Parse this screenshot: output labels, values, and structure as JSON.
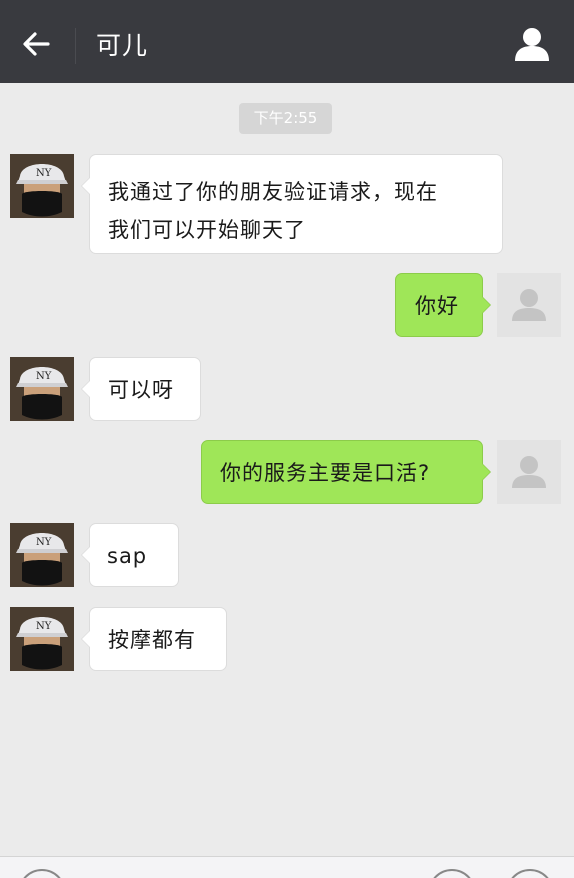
{
  "header": {
    "title": "可儿",
    "back_icon": "arrow-left-icon",
    "profile_icon": "person-icon"
  },
  "timestamp": "下午2:55",
  "messages": [
    {
      "side": "left",
      "lines": [
        "我通过了你的朋友验证请求，现在",
        "我们可以开始聊天了"
      ]
    },
    {
      "side": "right",
      "lines": [
        "你好"
      ]
    },
    {
      "side": "left",
      "lines": [
        "可以呀"
      ]
    },
    {
      "side": "right",
      "lines": [
        "你的服务主要是口活?"
      ]
    },
    {
      "side": "left",
      "lines": [
        "sap"
      ]
    },
    {
      "side": "left",
      "lines": [
        "按摩都有"
      ]
    }
  ],
  "colors": {
    "header_bg": "#393a3f",
    "chat_bg": "#ebebeb",
    "outgoing_bubble": "#9fe658",
    "incoming_bubble": "#ffffff"
  }
}
